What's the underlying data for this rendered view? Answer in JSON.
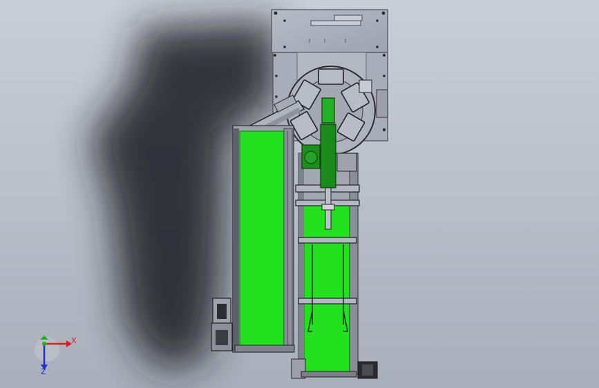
{
  "viewport": {
    "background_top": "#c9ced6",
    "background_bottom": "#a9afba"
  },
  "colors": {
    "belt_green": "#22e01e",
    "dark_green": "#1a8f1a",
    "frame_gray": "#a8acb8",
    "frame_dark": "#3a3d44",
    "axis_x": "#d42020",
    "axis_y": "#22b022",
    "axis_z": "#2030c8"
  },
  "triad": {
    "x_label": "X",
    "z_label": "Z"
  }
}
